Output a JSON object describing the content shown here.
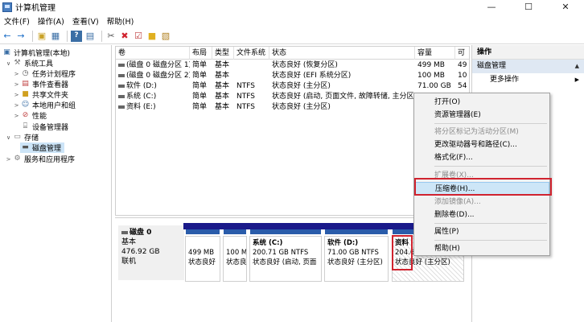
{
  "window": {
    "title": "计算机管理",
    "buttons": {
      "minimize": "—",
      "maximize": "☐",
      "close": "✕"
    }
  },
  "menu": [
    "文件(F)",
    "操作(A)",
    "查看(V)",
    "帮助(H)"
  ],
  "toolbar_icons": [
    "back-icon",
    "forward-icon",
    "up-folder-icon",
    "console-tree-icon",
    "help-icon",
    "properties-icon",
    "connect-icon",
    "delete-icon",
    "check-icon",
    "yellow-folder-icon",
    "export-icon"
  ],
  "tree": {
    "root": "计算机管理(本地)",
    "system_tools": "系统工具",
    "task_scheduler": "任务计划程序",
    "event_viewer": "事件查看器",
    "shared_folders": "共享文件夹",
    "local_users": "本地用户和组",
    "performance": "性能",
    "device_manager": "设备管理器",
    "storage": "存储",
    "disk_management": "磁盘管理",
    "services": "服务和应用程序"
  },
  "volume_table": {
    "headers": [
      "卷",
      "布局",
      "类型",
      "文件系统",
      "状态",
      "容量",
      "可"
    ],
    "rows": [
      [
        "(磁盘 0 磁盘分区 1)",
        "简单",
        "基本",
        "",
        "状态良好 (恢复分区)",
        "499 MB",
        "49"
      ],
      [
        "(磁盘 0 磁盘分区 2)",
        "简单",
        "基本",
        "",
        "状态良好 (EFI 系统分区)",
        "100 MB",
        "10"
      ],
      [
        "软件 (D:)",
        "简单",
        "基本",
        "NTFS",
        "状态良好 (主分区)",
        "71.00 GB",
        "54"
      ],
      [
        "系统 (C:)",
        "简单",
        "基本",
        "NTFS",
        "状态良好 (启动, 页面文件, 故障转储, 主分区)",
        "",
        ""
      ],
      [
        "资料 (E:)",
        "简单",
        "基本",
        "NTFS",
        "状态良好 (主分区)",
        "",
        ""
      ]
    ]
  },
  "disk0": {
    "name": "磁盘 0",
    "type": "基本",
    "size": "476.92 GB",
    "status": "联机"
  },
  "partitions": [
    {
      "name": "",
      "size": "499 MB",
      "status": "状态良好"
    },
    {
      "name": "",
      "size": "100 M",
      "status": "状态良"
    },
    {
      "name": "系统 (C:)",
      "size": "200.71 GB NTFS",
      "status": "状态良好 (启动, 页面"
    },
    {
      "name": "软件 (D:)",
      "size": "71.00 GB NTFS",
      "status": "状态良好 (主分区)"
    },
    {
      "name": "资料",
      "size": "204.6",
      "status": "状态良好 (主分区)"
    }
  ],
  "actions": {
    "header": "操作",
    "section": "磁盘管理",
    "more": "更多操作"
  },
  "context_menu": [
    {
      "label": "打开(O)",
      "disabled": false
    },
    {
      "label": "资源管理器(E)",
      "disabled": false
    },
    {
      "label": "将分区标记为活动分区(M)",
      "disabled": true
    },
    {
      "label": "更改驱动器号和路径(C)...",
      "disabled": false
    },
    {
      "label": "格式化(F)...",
      "disabled": false
    },
    {
      "label": "扩展卷(X)...",
      "disabled": true
    },
    {
      "label": "压缩卷(H)...",
      "disabled": false
    },
    {
      "label": "添加镜像(A)...",
      "disabled": true
    },
    {
      "label": "删除卷(D)...",
      "disabled": false
    },
    {
      "label": "属性(P)",
      "disabled": false
    },
    {
      "label": "帮助(H)",
      "disabled": false
    }
  ],
  "colors": {
    "highlight_red": "#d0232f",
    "disk_strip": "#1a1a8a",
    "selection": "#cce4f7"
  }
}
